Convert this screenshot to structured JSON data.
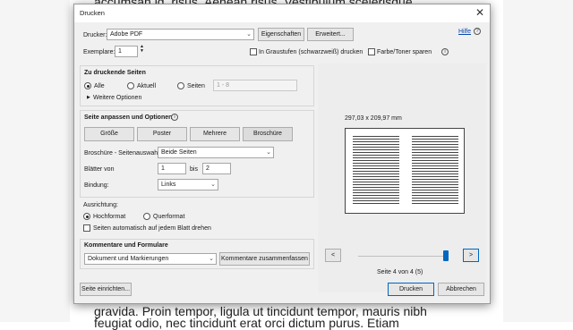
{
  "background": {
    "top_text": "accumsan id, risus. Aenean risus. Vestibulum scelerisque",
    "bottom_text_1": "gravida. Proin tempor, ligula ut tincidunt tempor, mauris nibh",
    "bottom_text_2": "feugiat odio, nec tincidunt erat orci dictum purus. Etiam"
  },
  "dialog": {
    "title": "Drucken",
    "close_label": "✕",
    "help_link": "Hilfe",
    "printer": {
      "label": "Drucker:",
      "value": "Adobe PDF",
      "properties_button": "Eigenschaften",
      "advanced_button": "Erweitert..."
    },
    "copies": {
      "label": "Exemplare:",
      "value": "1"
    },
    "grayscale_label": "In Graustufen (schwarzweiß) drucken",
    "save_ink_label": "Farbe/Toner sparen",
    "pages": {
      "heading": "Zu druckende Seiten",
      "all": "Alle",
      "current": "Aktuell",
      "pages": "Seiten",
      "range_placeholder": "1 - 8",
      "more_options": "Weitere Optionen"
    },
    "fit": {
      "heading": "Seite anpassen und Optionen",
      "tabs": [
        "Größe",
        "Poster",
        "Mehrere",
        "Broschüre"
      ],
      "booklet_label": "Broschüre - Seitenauswahl:",
      "booklet_value": "Beide Seiten",
      "sheets_label": "Blätter von",
      "sheets_from": "1",
      "sheets_to_label": "bis",
      "sheets_to": "2",
      "binding_label": "Bindung:",
      "binding_value": "Links"
    },
    "orientation": {
      "heading": "Ausrichtung:",
      "portrait": "Hochformat",
      "landscape": "Querformat",
      "auto_rotate": "Seiten automatisch auf jedem Blatt drehen"
    },
    "comments": {
      "heading": "Kommentare und Formulare",
      "value": "Dokument und Markierungen",
      "summarize_button": "Kommentare zusammenfassen"
    },
    "preview": {
      "size_label": "297,03 x 209,97 mm",
      "page_label": "Seite 4 von 4 (5)",
      "prev": "<",
      "next": ">",
      "slider_level_fraction": 1.0
    },
    "page_setup_button": "Seite einrichten...",
    "print_button": "Drucken",
    "cancel_button": "Abbrechen"
  }
}
